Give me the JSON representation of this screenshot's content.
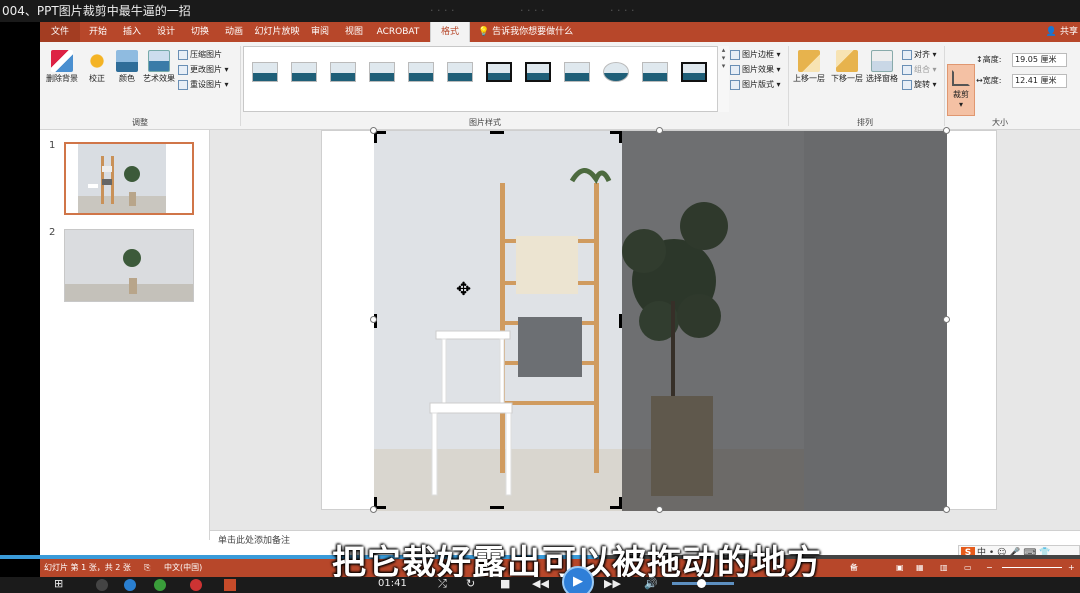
{
  "video": {
    "title": "004、PPT图片裁剪中最牛逼的一招",
    "subtitle": "把它裁好露出可以被拖动的地方",
    "time_current": "01:41",
    "progress_fraction": 0.555
  },
  "ppt": {
    "tabs": [
      "文件",
      "开始",
      "插入",
      "设计",
      "切换",
      "动画",
      "幻灯片放映",
      "审阅",
      "视图",
      "ACROBAT",
      "格式"
    ],
    "active_tab": "格式",
    "tell_me": "告诉我你想要做什么",
    "share": "共享",
    "ribbon": {
      "adjust": {
        "remove_bg": "删除背景",
        "corrections": "校正",
        "color": "颜色",
        "artistic": "艺术效果",
        "compress": "压缩图片",
        "change": "更改图片",
        "reset": "重设图片",
        "group_label": "调整"
      },
      "styles": {
        "group_label": "图片样式",
        "border": "图片边框",
        "effects": "图片效果",
        "layout": "图片版式"
      },
      "arrange": {
        "bring_forward": "上移一层",
        "send_backward": "下移一层",
        "selection_pane": "选择窗格",
        "align": "对齐",
        "group": "组合",
        "rotate": "旋转",
        "group_label": "排列"
      },
      "size": {
        "crop": "裁剪",
        "height_label": "高度:",
        "height_value": "19.05 厘米",
        "width_label": "宽度:",
        "width_value": "12.41 厘米",
        "group_label": "大小"
      }
    },
    "slides": [
      {
        "number": "1",
        "selected": true
      },
      {
        "number": "2",
        "selected": false
      }
    ],
    "notes_placeholder": "单击此处添加备注",
    "status": {
      "slide_info": "幻灯片 第 1 张，共 2 张",
      "language": "中文(中国)",
      "notes": "备注",
      "comments": "批注"
    }
  },
  "ime": {
    "label": "中"
  },
  "colors": {
    "accent": "#b7472a",
    "player_blue": "#2f7fd8"
  }
}
